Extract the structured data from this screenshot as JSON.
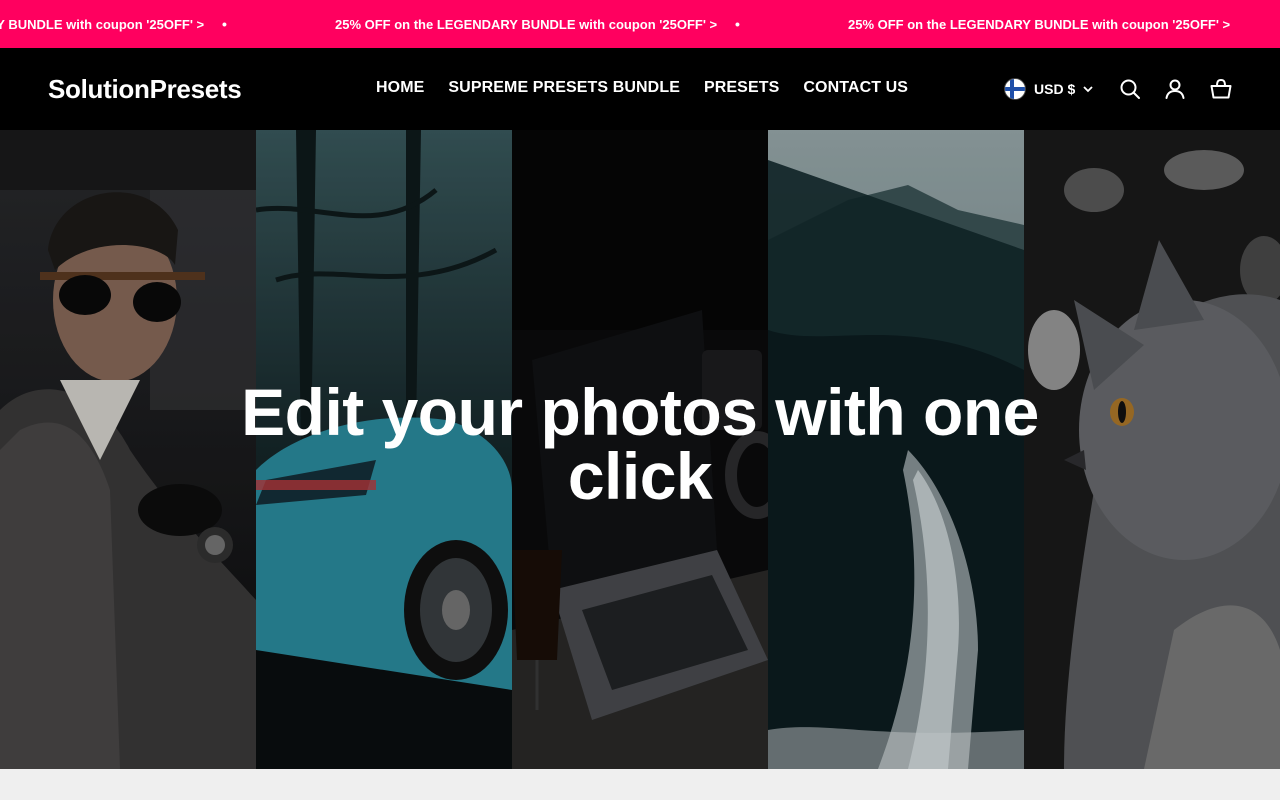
{
  "announcement": {
    "text": "25% OFF on the LEGENDARY BUNDLE with coupon '25OFF' >",
    "separator": "•",
    "background": "#ff005f"
  },
  "header": {
    "logo": "SolutionPresets",
    "nav": [
      {
        "label": "HOME"
      },
      {
        "label": "SUPREME PRESETS BUNDLE"
      },
      {
        "label": "PRESETS"
      },
      {
        "label": "CONTACT US"
      }
    ],
    "currency": {
      "label": "USD $",
      "flag": "finland-flag-icon"
    },
    "icons": [
      "search-icon",
      "account-icon",
      "cart-icon"
    ]
  },
  "hero": {
    "title_line1": "Edit your photos with one",
    "title_line2": "click",
    "panels": [
      "man-with-sunglasses",
      "blue-sports-car",
      "laptop-desk",
      "forest-bridge",
      "grey-cat"
    ]
  }
}
